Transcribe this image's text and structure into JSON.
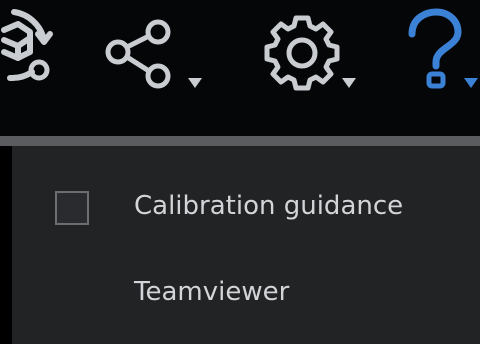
{
  "toolbar": {
    "icons": [
      {
        "name": "cube-rotate-icon"
      },
      {
        "name": "share-icon"
      },
      {
        "name": "settings-gear-icon"
      },
      {
        "name": "help-icon"
      }
    ],
    "colors": {
      "icon": "#c9ccd1",
      "help_accent": "#3b82d6",
      "background": "#050608"
    }
  },
  "help_menu": {
    "items": [
      {
        "label": "Calibration guidance",
        "has_checkbox": true,
        "checked": false
      },
      {
        "label": "Teamviewer",
        "has_checkbox": false
      }
    ],
    "colors": {
      "background": "#222325",
      "text": "#d2d4d8"
    }
  }
}
